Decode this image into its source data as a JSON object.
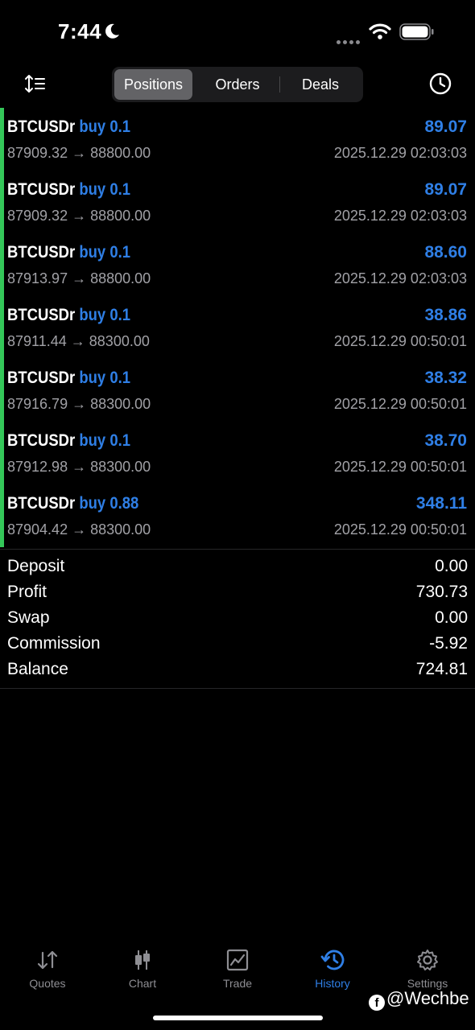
{
  "status": {
    "time": "7:44"
  },
  "header": {
    "tabs": [
      {
        "label": "Positions",
        "active": true
      },
      {
        "label": "Orders",
        "active": false
      },
      {
        "label": "Deals",
        "active": false
      }
    ]
  },
  "positions": [
    {
      "symbol": "BTCUSDr",
      "side": "buy 0.1",
      "profit": "89.07",
      "open": "87909.32",
      "close": "88800.00",
      "time": "2025.12.29 02:03:03"
    },
    {
      "symbol": "BTCUSDr",
      "side": "buy 0.1",
      "profit": "89.07",
      "open": "87909.32",
      "close": "88800.00",
      "time": "2025.12.29 02:03:03"
    },
    {
      "symbol": "BTCUSDr",
      "side": "buy 0.1",
      "profit": "88.60",
      "open": "87913.97",
      "close": "88800.00",
      "time": "2025.12.29 02:03:03"
    },
    {
      "symbol": "BTCUSDr",
      "side": "buy 0.1",
      "profit": "38.86",
      "open": "87911.44",
      "close": "88300.00",
      "time": "2025.12.29 00:50:01"
    },
    {
      "symbol": "BTCUSDr",
      "side": "buy 0.1",
      "profit": "38.32",
      "open": "87916.79",
      "close": "88300.00",
      "time": "2025.12.29 00:50:01"
    },
    {
      "symbol": "BTCUSDr",
      "side": "buy 0.1",
      "profit": "38.70",
      "open": "87912.98",
      "close": "88300.00",
      "time": "2025.12.29 00:50:01"
    },
    {
      "symbol": "BTCUSDr",
      "side": "buy 0.88",
      "profit": "348.11",
      "open": "87904.42",
      "close": "88300.00",
      "time": "2025.12.29 00:50:01"
    }
  ],
  "arrow": "→",
  "summary": [
    {
      "label": "Deposit",
      "value": "0.00"
    },
    {
      "label": "Profit",
      "value": "730.73"
    },
    {
      "label": "Swap",
      "value": "0.00"
    },
    {
      "label": "Commission",
      "value": "-5.92"
    },
    {
      "label": "Balance",
      "value": "724.81"
    }
  ],
  "tabbar": [
    {
      "label": "Quotes",
      "icon": "quotes-icon"
    },
    {
      "label": "Chart",
      "icon": "chart-icon"
    },
    {
      "label": "Trade",
      "icon": "trade-icon"
    },
    {
      "label": "History",
      "icon": "history-icon",
      "active": true
    },
    {
      "label": "Settings",
      "icon": "settings-icon"
    }
  ],
  "watermark": "@Wechbe",
  "colors": {
    "accent": "#2f7fe6",
    "buy_bar": "#34c759",
    "secondary_text": "#a1a1a6"
  }
}
